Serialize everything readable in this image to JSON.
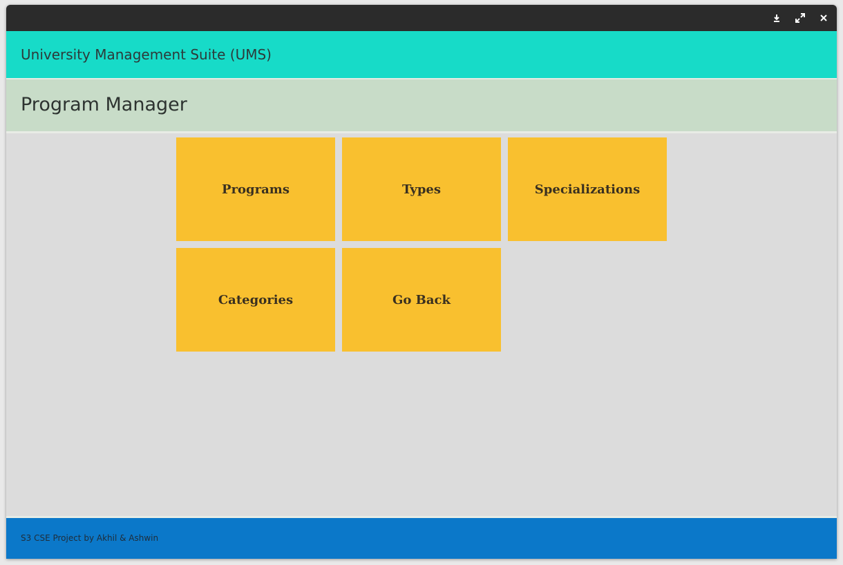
{
  "window": {
    "controls": {
      "minimize_icon": "download-arrow-icon",
      "maximize_icon": "expand-icon",
      "close_icon": "close-icon"
    }
  },
  "header": {
    "app_title": "University Management Suite (UMS)"
  },
  "page": {
    "title": "Program Manager"
  },
  "tiles": [
    {
      "label": "Programs"
    },
    {
      "label": "Types"
    },
    {
      "label": "Specializations"
    },
    {
      "label": "Categories"
    },
    {
      "label": "Go Back"
    }
  ],
  "footer": {
    "text": "S3 CSE Project by Akhil & Ashwin"
  },
  "colors": {
    "titlebar": "#2b2b2b",
    "app_header": "#17dbc8",
    "page_header": "#c8dcc8",
    "content_bg": "#dcdcdc",
    "tile": "#f9c02f",
    "footer": "#0b78c9"
  }
}
